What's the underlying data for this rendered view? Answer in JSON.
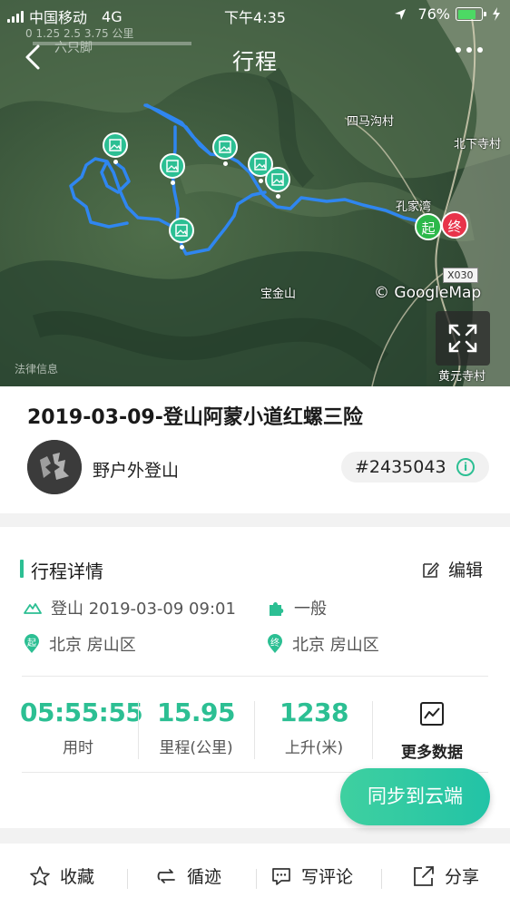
{
  "status_bar": {
    "carrier": "中国移动",
    "network": "4G",
    "time": "下午4:35",
    "battery_text": "76%",
    "battery_level": 0.76
  },
  "map": {
    "scale_label": "0   1.25   2.5   3.75 公里",
    "scale_place": "六只脚",
    "places": [
      "四马沟村",
      "北下寺村",
      "孔家湾",
      "宝金山",
      "黄元寺村"
    ],
    "road_badge": "X030",
    "copyright": "© GoogleMap",
    "legal": "法律信息",
    "start_label": "起",
    "end_label": "终",
    "route_color": "#2f86f0",
    "pin_color": "#2cbf93"
  },
  "nav": {
    "title": "行程"
  },
  "trip": {
    "title": "2019-03-09-登山阿蒙小道红螺三险",
    "author": "野户外登山",
    "id": "#2435043"
  },
  "details": {
    "section_title": "行程详情",
    "edit_label": "编辑",
    "activity": "登山 2019-03-09 09:01",
    "difficulty": "一般",
    "start_place": "北京 房山区",
    "end_place": "北京 房山区",
    "start_icon_label": "起",
    "end_icon_label": "终",
    "stats": [
      {
        "value": "05:55:55",
        "label": "用时"
      },
      {
        "value": "15.95",
        "label": "里程(公里)"
      },
      {
        "value": "1238",
        "label": "上升(米)"
      }
    ],
    "more_data_label": "更多数据",
    "accent_color": "#2cbf93"
  },
  "sync_button": "同步到云端",
  "bottom_bar": {
    "favorite": "收藏",
    "follow_track": "循迹",
    "comment": "写评论",
    "share": "分享"
  }
}
